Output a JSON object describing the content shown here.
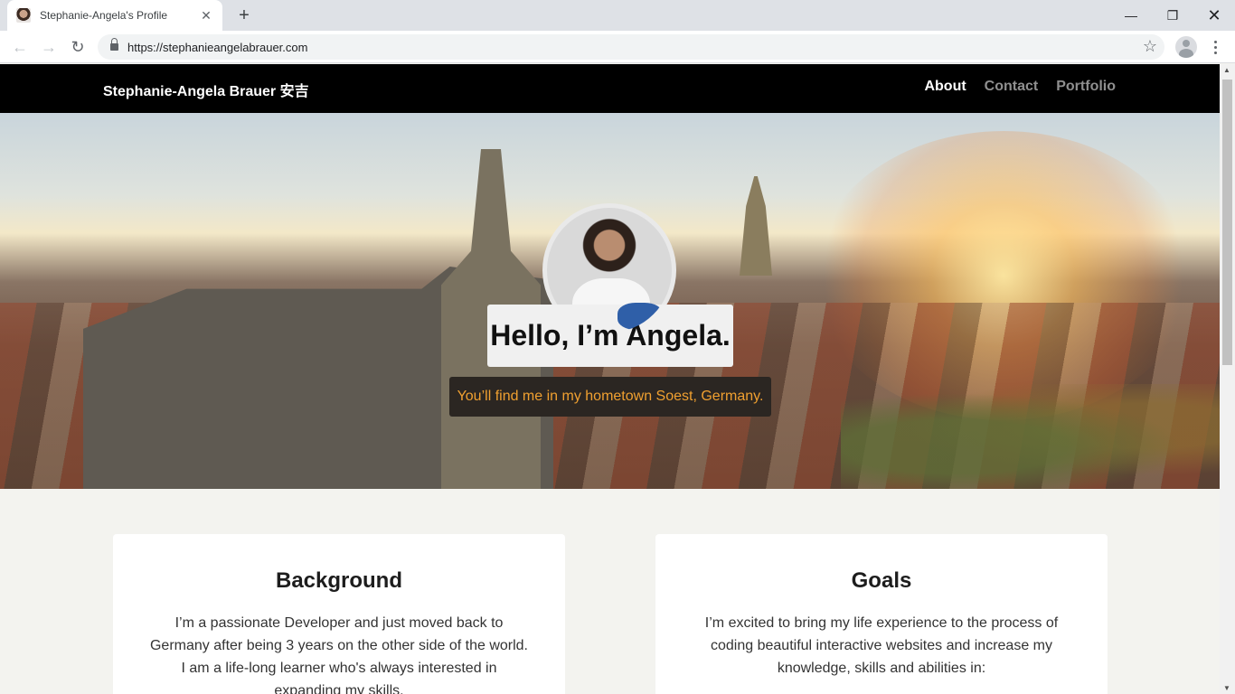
{
  "browser": {
    "tab_title": "Stephanie-Angela's Profile",
    "tab_close": "✕",
    "new_tab": "+",
    "url": "https://stephanieangelabrauer.com",
    "window_controls": {
      "minimize": "—",
      "maximize": "❐",
      "close": "✕"
    },
    "nav": {
      "back": "←",
      "forward": "→",
      "reload": "↻"
    },
    "star": "☆"
  },
  "site": {
    "brand": "Stephanie-Angela Brauer 安吉",
    "nav_links": [
      "About",
      "Contact",
      "Portfolio"
    ],
    "active_link": "About"
  },
  "hero": {
    "title": "Hello, I’m Angela.",
    "subtitle": "You’ll find me in my hometown Soest, Germany."
  },
  "cards": {
    "background": {
      "title": "Background",
      "text": "I’m a passionate Developer and just moved back to Germany after being 3 years on the other side of the world. I am a life-long learner who's always interested in expanding my skills."
    },
    "goals": {
      "title": "Goals",
      "text": "I’m excited to bring my life experience to the process of coding beautiful interactive websites and increase my knowledge, skills and abilities in:"
    }
  },
  "colors": {
    "nav_bg": "#000000",
    "nav_inactive": "#8f8f8f",
    "subtitle_text": "#f0a030",
    "page_bg": "#f3f3ef"
  }
}
